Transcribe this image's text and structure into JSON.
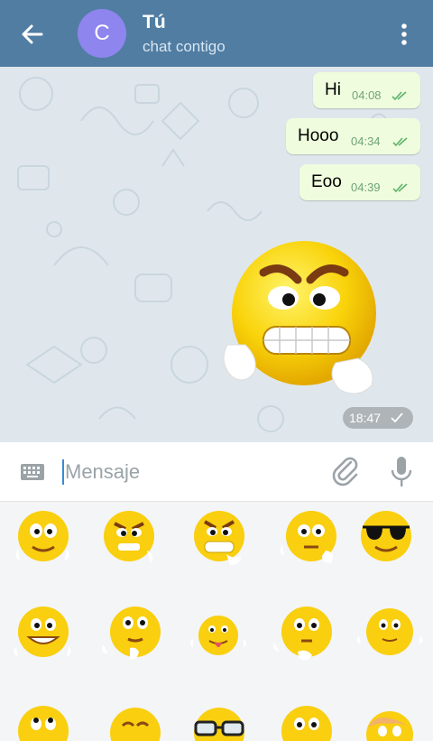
{
  "header": {
    "avatar_letter": "C",
    "title": "Tú",
    "subtitle": "chat contigo",
    "icons": {
      "back": "arrow-left-icon",
      "menu": "more-vertical-icon"
    }
  },
  "messages": [
    {
      "text": "Hi",
      "time": "04:08",
      "status": "read"
    },
    {
      "text": "Hooo",
      "time": "04:34",
      "status": "read"
    },
    {
      "text": "Eoo",
      "time": "04:39",
      "status": "read"
    }
  ],
  "sticker_message": {
    "time": "18:47",
    "status": "sent",
    "sticker": "angry-emoji-sticker"
  },
  "composer": {
    "placeholder": "Mensaje",
    "value": "",
    "icons": [
      "keyboard-icon",
      "paperclip-icon",
      "microphone-icon"
    ]
  },
  "sticker_panel": {
    "stickers": [
      "smiling-emoji-sticker",
      "angry-emoji-sticker",
      "grimace-emoji-sticker",
      "thinking-emoji-sticker",
      "sunglasses-emoji-sticker",
      "happy-emoji-sticker",
      "thoughtful-emoji-sticker",
      "tongue-out-emoji-sticker",
      "curious-emoji-sticker",
      "nervous-emoji-sticker",
      "rolling-eyes-emoji-sticker",
      "pleased-emoji-sticker",
      "nerd-glasses-emoji-sticker",
      "worried-emoji-sticker",
      "blonde-emoji-sticker"
    ]
  },
  "colors": {
    "header": "#517da2",
    "avatar": "#8e85ee",
    "bubble": "#effdde",
    "chat_bg": "#dfe7ec",
    "accent": "#3a8ad5"
  }
}
